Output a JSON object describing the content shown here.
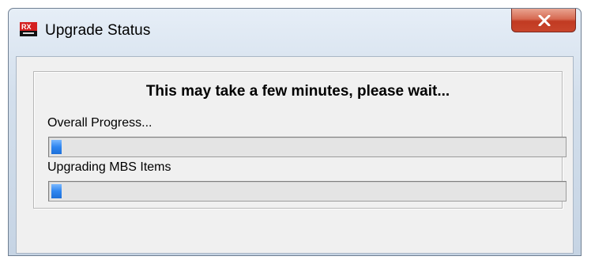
{
  "window": {
    "title": "Upgrade Status",
    "icon": "app-logo-icon",
    "close_icon": "close-icon"
  },
  "dialog": {
    "message": "This may take a few minutes, please wait...",
    "progress_items": [
      {
        "label": "Overall Progress...",
        "value_percent": 2
      },
      {
        "label": "Upgrading MBS Items",
        "value_percent": 2
      }
    ]
  },
  "colors": {
    "progress_fill": "#2f86f0",
    "close_button": "#c8452b"
  }
}
